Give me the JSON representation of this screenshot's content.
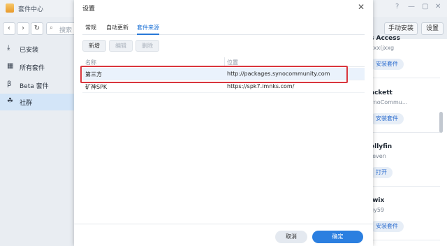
{
  "app": {
    "title": "套件中心",
    "window_controls": {
      "help": "?",
      "minimize": "—",
      "maximize": "▢",
      "close": "✕"
    }
  },
  "toolbar": {
    "back": "‹",
    "forward": "›",
    "refresh": "↻",
    "search_placeholder": "搜索",
    "manual_install": "手动安装",
    "settings": "设置"
  },
  "sidebar": {
    "items": [
      {
        "label": "已安装",
        "icon": "download-icon",
        "glyph": "⤓",
        "active": false
      },
      {
        "label": "所有套件",
        "icon": "grid-icon",
        "glyph": "▦",
        "active": false
      },
      {
        "label": "Beta 套件",
        "icon": "beta-icon",
        "glyph": "β",
        "active": false
      },
      {
        "label": "社群",
        "icon": "community-icon",
        "glyph": "☘",
        "active": true
      }
    ]
  },
  "packages": [
    {
      "name": "s Access",
      "sub": "xxx(jxxg",
      "action": "安装套件"
    },
    {
      "name": "ackett",
      "sub": "ynoCommu...",
      "action": "安装套件"
    },
    {
      "name": "ellyfin",
      "sub": "teven",
      "action": "打开"
    },
    {
      "name": "iwix",
      "sub": "gy59",
      "action": "安装套件"
    }
  ],
  "dialog": {
    "title": "设置",
    "close": "✕",
    "tabs": [
      {
        "label": "常规",
        "active": false
      },
      {
        "label": "自动更新",
        "active": false
      },
      {
        "label": "套件来源",
        "active": true
      }
    ],
    "actions": {
      "add": "新增",
      "edit": "编辑",
      "delete": "删除"
    },
    "columns": {
      "name": "名称",
      "location": "位置"
    },
    "rows": [
      {
        "name": "第三方",
        "location": "http://packages.synocommunity.com",
        "selected": true
      },
      {
        "name": "矿神SPK",
        "location": "https://spk7.imnks.com/",
        "selected": false
      }
    ],
    "footer": {
      "cancel": "取消",
      "ok": "确定"
    }
  },
  "colors": {
    "accent": "#2b7fe0",
    "highlight": "#d9363e",
    "selected_row": "#eaf2fc"
  }
}
